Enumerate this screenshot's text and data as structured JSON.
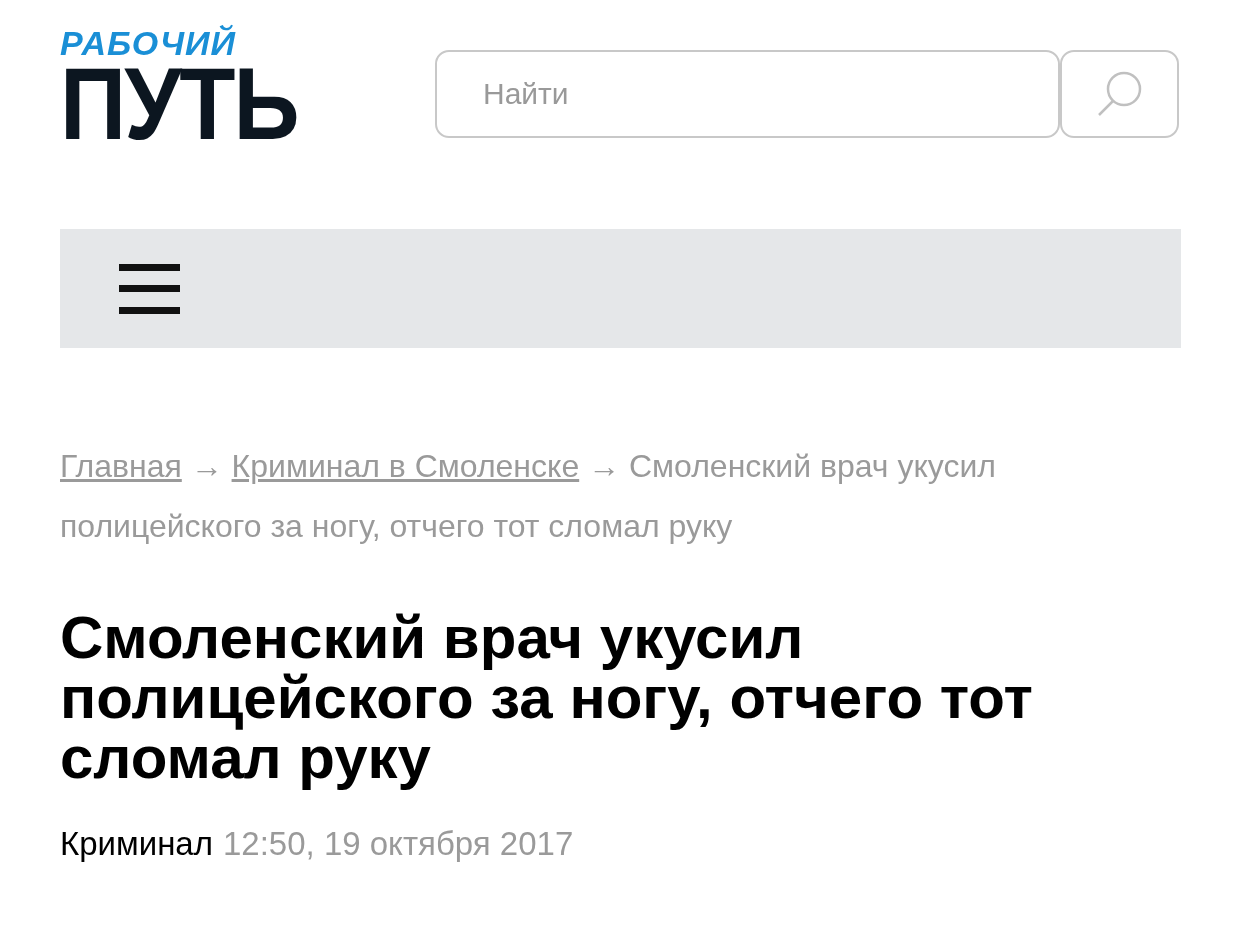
{
  "logo": {
    "top": "РАБОЧИЙ",
    "bottom": "ПУТЬ"
  },
  "search": {
    "placeholder": "Найти"
  },
  "breadcrumbs": [
    {
      "label": "Главная",
      "kind": "link"
    },
    {
      "label": "Криминал в Смоленске",
      "kind": "link"
    },
    {
      "label": "Смоленский врач укусил полицейского за ногу, отчего тот сломал руку",
      "kind": "current"
    }
  ],
  "separator": "→",
  "article": {
    "title": "Смоленский врач укусил полицейского за ногу, отчего тот сломал руку",
    "category": "Криминал",
    "date": "12:50, 19 октября 2017"
  }
}
